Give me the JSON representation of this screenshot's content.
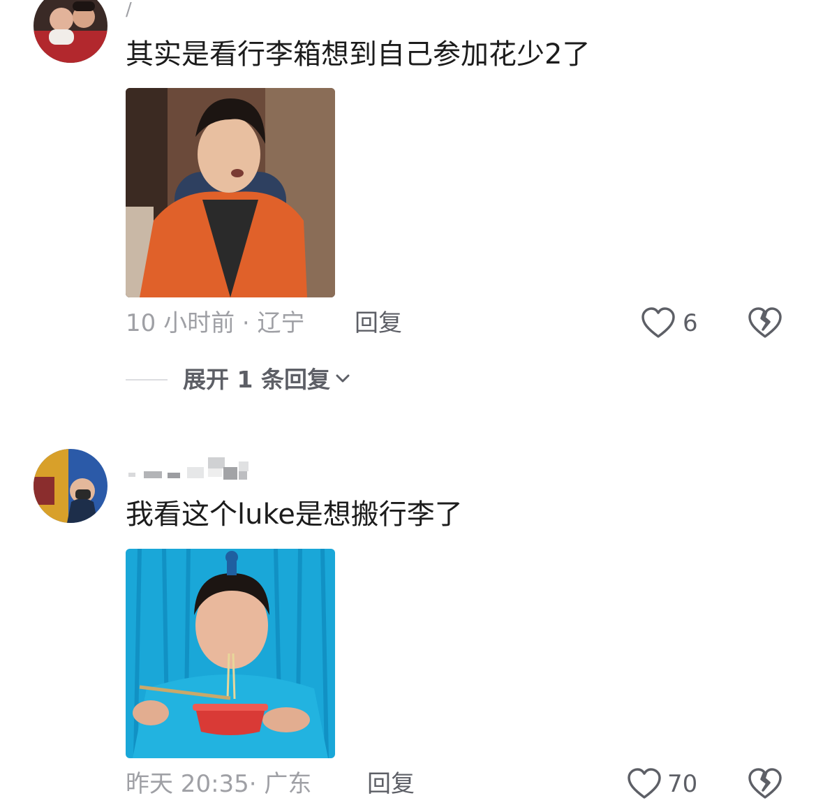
{
  "comments": [
    {
      "username": "/",
      "text": "其实是看行李箱想到自己参加花少2了",
      "time": "10 小时前",
      "location": "辽宁",
      "reply_label": "回复",
      "likes": "6",
      "expand_label": "展开 1 条回复"
    },
    {
      "text": "我看这个luke是想搬行李了",
      "time": "昨天 20:35",
      "location": "广东",
      "reply_label": "回复",
      "likes": "70"
    }
  ],
  "meta_separator": "·",
  "colors": {
    "meta": "#9fa0a5",
    "text": "#1c1c1c",
    "action": "#5d5f66"
  },
  "icons": {
    "like": "heart-outline-icon",
    "dislike": "broken-heart-icon",
    "expand": "chevron-down-icon"
  }
}
